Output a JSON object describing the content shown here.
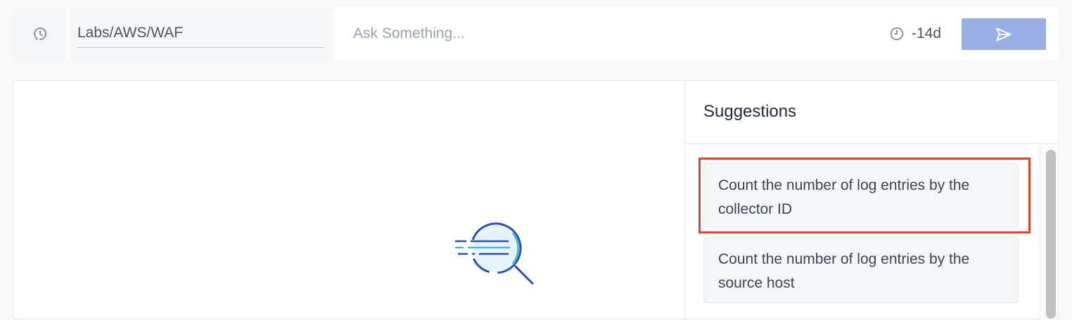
{
  "header": {
    "history_icon": "history-clock-icon",
    "scope_value": "Labs/AWS/WAF",
    "ask_placeholder": "Ask Something...",
    "time_range_icon": "clock-icon",
    "time_range_label": "-14d",
    "send_icon": "paper-plane-icon",
    "send_button_color": "#9aaee6"
  },
  "main": {
    "empty_state_icon": "magnifier-log-lines-icon"
  },
  "suggestions": {
    "title": "Suggestions",
    "items": [
      {
        "label": "Count the number of log entries by the collector ID",
        "highlighted": true
      },
      {
        "label": "Count the number of log entries by the source host",
        "highlighted": false
      }
    ],
    "highlight_color": "#e8402a"
  }
}
